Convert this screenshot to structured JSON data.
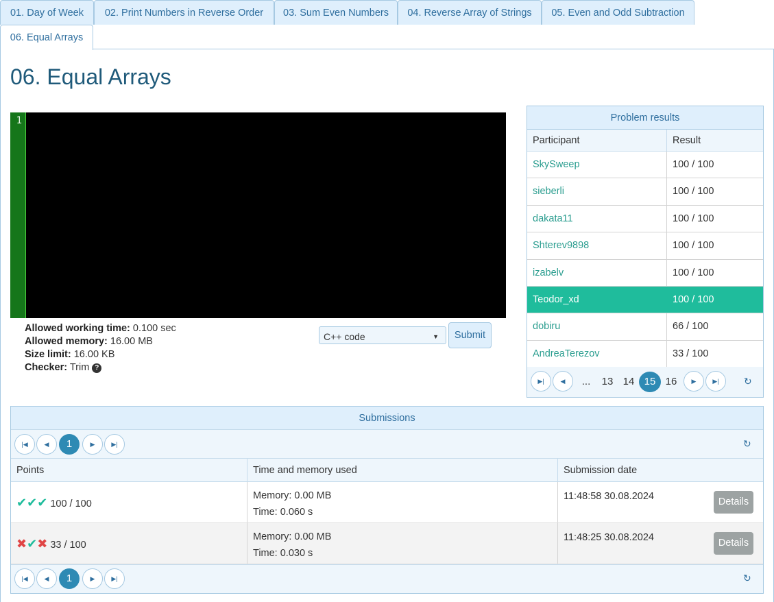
{
  "tabs": [
    "01. Day of Week",
    "02. Print Numbers in Reverse Order",
    "03. Sum Even Numbers",
    "04. Reverse Array of Strings",
    "05. Even and Odd Subtraction",
    "06. Equal Arrays"
  ],
  "page_title": "06. Equal Arrays",
  "editor": {
    "line_number": "1"
  },
  "limits": {
    "time_label": "Allowed working time:",
    "time_value": "0.100 sec",
    "memory_label": "Allowed memory:",
    "memory_value": "16.00 MB",
    "size_label": "Size limit:",
    "size_value": "16.00 KB",
    "checker_label": "Checker:",
    "checker_value": "Trim"
  },
  "language_select": "C++ code",
  "submit_label": "Submit",
  "results": {
    "title": "Problem results",
    "col_participant": "Participant",
    "col_result": "Result",
    "rows": [
      {
        "participant": "SkySweep",
        "result": "100 / 100"
      },
      {
        "participant": "sieberli",
        "result": "100 / 100"
      },
      {
        "participant": "dakata11",
        "result": "100 / 100"
      },
      {
        "participant": "Shterev9898",
        "result": "100 / 100"
      },
      {
        "participant": "izabelv",
        "result": "100 / 100"
      },
      {
        "participant": "Teodor_xd",
        "result": "100 / 100"
      },
      {
        "participant": "dobiru",
        "result": "66 / 100"
      },
      {
        "participant": "AndreaTerezov",
        "result": "33 / 100"
      }
    ],
    "pager": {
      "ellipsis": "...",
      "pages": [
        "13",
        "14",
        "15",
        "16"
      ],
      "current": "15"
    }
  },
  "submissions": {
    "title": "Submissions",
    "page": "1",
    "col_points": "Points",
    "col_time_memory": "Time and memory used",
    "col_date": "Submission date",
    "rows": [
      {
        "marks": [
          "ok",
          "ok",
          "ok"
        ],
        "points": "100 / 100",
        "memory": "Memory: 0.00 MB",
        "time": "Time: 0.060 s",
        "date": "11:48:58 30.08.2024",
        "details": "Details"
      },
      {
        "marks": [
          "bad",
          "ok",
          "bad"
        ],
        "points": "33 / 100",
        "memory": "Memory: 0.00 MB",
        "time": "Time: 0.030 s",
        "date": "11:48:25 30.08.2024",
        "details": "Details"
      }
    ]
  },
  "icons": {
    "first": "first-page-icon",
    "prev": "prev-page-icon",
    "next": "next-page-icon",
    "last": "last-page-icon",
    "refresh": "refresh-icon",
    "help": "help-icon",
    "check": "check-icon",
    "cross": "cross-icon",
    "dropdown": "chevron-down-icon"
  },
  "colors": {
    "accent": "#1fbc9c",
    "tab_bg": "#dfeffc",
    "tab_text": "#2e6e9e",
    "editor_bg": "#000000",
    "gutter_bg": "#15761a",
    "error": "#e04545"
  }
}
